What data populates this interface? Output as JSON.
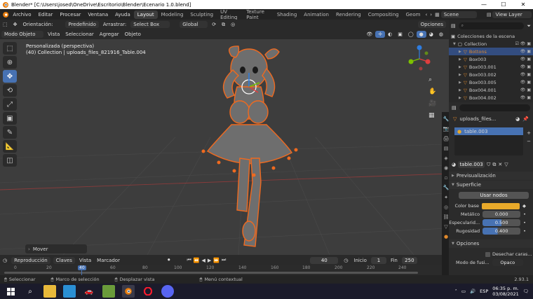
{
  "titlebar": {
    "title": "Blender* [C:\\Users\\josed\\OneDrive\\Escritorio\\Blender\\Ecenario 1.0.blend]",
    "minimize": "—",
    "maximize": "☐",
    "close": "✕"
  },
  "menu": {
    "file": "Archivo",
    "edit": "Editar",
    "render": "Procesar",
    "window": "Ventana",
    "help": "Ayuda"
  },
  "workspaces": [
    "Layout",
    "Modeling",
    "Sculpting",
    "UV Editing",
    "Texture Paint",
    "Shading",
    "Animation",
    "Rendering",
    "Compositing",
    "Geom"
  ],
  "scene": {
    "label": "Scene",
    "view_layer": "View Layer"
  },
  "tool_header": {
    "orientation_label": "Orientación:",
    "orientation_value": "Predefinido",
    "drag_label": "Arrastrar:",
    "drag_value": "Select Box",
    "transform_value": "Global",
    "options": "Opciones"
  },
  "view_header": {
    "mode": "Modo Objeto",
    "view": "Vista",
    "select": "Seleccionar",
    "add": "Agregar",
    "object": "Objeto"
  },
  "viewport": {
    "view_name": "Personalizada (perspectiva)",
    "collection_info": "(40) Collection | uploads_files_821916_Table.004",
    "operator_panel": "Mover"
  },
  "gizmo": {
    "x": "X",
    "y": "Y",
    "z": "Z"
  },
  "outliner": {
    "search_placeholder": "",
    "root": "Colecciones de la escena",
    "collection": "Collection",
    "items": [
      {
        "name": "Bottons"
      },
      {
        "name": "Box003"
      },
      {
        "name": "Box003.001"
      },
      {
        "name": "Box003.002"
      },
      {
        "name": "Box003.005"
      },
      {
        "name": "Box004.001"
      },
      {
        "name": "Box004.002"
      }
    ]
  },
  "properties": {
    "object_name": "uploads_files...",
    "material_slot": "table.003",
    "material_name": "table.003",
    "preview_label": "Previsualización",
    "surface_label": "Superficie",
    "use_nodes": "Usar nodos",
    "base_color_label": "Color base",
    "base_color": "#e8a92a",
    "metallic_label": "Metálico",
    "metallic_value": "0.000",
    "specular_label": "Especularid...",
    "specular_value": "0.500",
    "roughness_label": "Rugosidad",
    "roughness_value": "0.400",
    "options_label": "Opciones",
    "backface_label": "Desechar caras...",
    "blend_mode_label": "Modo de fusi...",
    "blend_mode_value": "Opaco"
  },
  "timeline": {
    "playback": "Reproducción",
    "keys": "Claves",
    "view": "Vista",
    "marker": "Marcador",
    "current_frame": "40",
    "start_label": "Inicio",
    "start_value": "1",
    "end_label": "Fin",
    "end_value": "250",
    "ticks": [
      "0",
      "20",
      "40",
      "60",
      "80",
      "100",
      "120",
      "140",
      "160",
      "180",
      "200",
      "220",
      "240"
    ]
  },
  "status": {
    "select": "Seleccionar",
    "box_select": "Marco de selección",
    "pan": "Desplazar vista",
    "context": "Menú contextual",
    "version": "2.93.1"
  },
  "taskbar": {
    "lang": "ESP",
    "time": "06:35 p. m.",
    "date": "03/08/2021"
  },
  "colors": {
    "accent": "#4772b3",
    "selected_orange": "#e0892c",
    "outline": "#f06a1f"
  }
}
